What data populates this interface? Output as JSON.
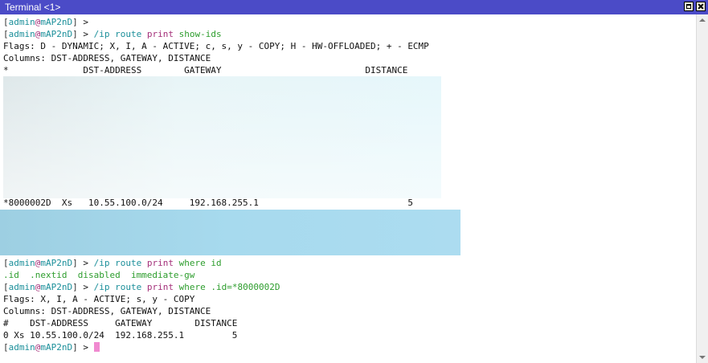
{
  "window": {
    "title": "Terminal <1>"
  },
  "prompt": {
    "open": "[",
    "user": "admin",
    "at": "@",
    "host": "mAP2nD",
    "close": "]",
    "arrow": ">"
  },
  "commands": {
    "c1": {
      "path": "/ip route",
      "verb": "print",
      "args": "show-ids"
    },
    "c2": {
      "path": "/ip route",
      "verb": "print",
      "args": "where id"
    },
    "c3": {
      "path": "/ip route",
      "verb": "print",
      "args": "where .id=*8000002D"
    }
  },
  "output": {
    "flags1": "Flags: D - DYNAMIC; X, I, A - ACTIVE; c, s, y - COPY; H - HW-OFFLOADED; + - ECMP",
    "cols1": "Columns: DST-ADDRESS, GATEWAY, DISTANCE",
    "header1": "*              DST-ADDRESS        GATEWAY                           DISTANCE",
    "row1": "*8000002D  Xs   10.55.100.0/24     192.168.255.1                            5",
    "completions": ".id  .nextid  disabled  immediate-gw",
    "flags2": "Flags: X, I, A - ACTIVE; s, y - COPY",
    "cols2": "Columns: DST-ADDRESS, GATEWAY, DISTANCE",
    "header2": "#    DST-ADDRESS     GATEWAY        DISTANCE",
    "row2": "0 Xs 10.55.100.0/24  192.168.255.1         5"
  },
  "colors": {
    "titlebar": "#4b4bc7",
    "prompt_user": "#1b8f9a",
    "prompt_at": "#a4307a",
    "command_verb": "#a4307a",
    "command_args": "#2d9d2d",
    "cursor": "#f08ad0"
  }
}
